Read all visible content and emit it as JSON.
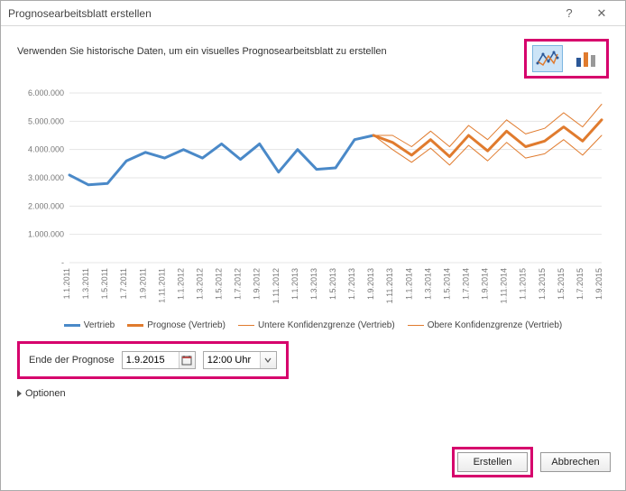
{
  "titlebar": {
    "title": "Prognosearbeitsblatt erstellen",
    "help": "?",
    "close": "✕"
  },
  "description": "Verwenden Sie historische Daten, um ein visuelles Prognosearbeitsblatt zu erstellen",
  "chart_type": {
    "line_selected": true
  },
  "chart_data": {
    "type": "line",
    "title": "",
    "xlabel": "",
    "ylabel": "",
    "ylim": [
      0,
      6000000
    ],
    "y_ticks": [
      "-",
      "1.000.000",
      "2.000.000",
      "3.000.000",
      "4.000.000",
      "5.000.000",
      "6.000.000"
    ],
    "categories": [
      "1.1.2011",
      "1.3.2011",
      "1.5.2011",
      "1.7.2011",
      "1.9.2011",
      "1.11.2011",
      "1.1.2012",
      "1.3.2012",
      "1.5.2012",
      "1.7.2012",
      "1.9.2012",
      "1.11.2012",
      "1.1.2013",
      "1.3.2013",
      "1.5.2013",
      "1.7.2013",
      "1.9.2013",
      "1.11.2013",
      "1.1.2014",
      "1.3.2014",
      "1.5.2014",
      "1.7.2014",
      "1.9.2014",
      "1.11.2014",
      "1.1.2015",
      "1.3.2015",
      "1.5.2015",
      "1.7.2015",
      "1.9.2015"
    ],
    "series": [
      {
        "name": "Vertrieb",
        "color": "#4a89c8",
        "width": 3,
        "values": [
          3100000,
          2750000,
          2800000,
          3600000,
          3900000,
          3700000,
          4000000,
          3700000,
          4200000,
          3650000,
          4200000,
          3200000,
          4000000,
          3300000,
          3350000,
          4350000,
          4500000,
          null,
          null,
          null,
          null,
          null,
          null,
          null,
          null,
          null,
          null,
          null,
          null
        ]
      },
      {
        "name": "Prognose (Vertrieb)",
        "color": "#e07b2e",
        "width": 3,
        "values": [
          null,
          null,
          null,
          null,
          null,
          null,
          null,
          null,
          null,
          null,
          null,
          null,
          null,
          null,
          null,
          null,
          4500000,
          4250000,
          3800000,
          4350000,
          3750000,
          4500000,
          3950000,
          4650000,
          4100000,
          4300000,
          4800000,
          4300000,
          5050000
        ]
      },
      {
        "name": "Untere Konfidenzgrenze (Vertrieb)",
        "color": "#e07b2e",
        "width": 1,
        "values": [
          null,
          null,
          null,
          null,
          null,
          null,
          null,
          null,
          null,
          null,
          null,
          null,
          null,
          null,
          null,
          null,
          4500000,
          4000000,
          3550000,
          4050000,
          3450000,
          4150000,
          3600000,
          4250000,
          3700000,
          3850000,
          4350000,
          3800000,
          4500000
        ]
      },
      {
        "name": "Obere Konfidenzgrenze (Vertrieb)",
        "color": "#e07b2e",
        "width": 1,
        "values": [
          null,
          null,
          null,
          null,
          null,
          null,
          null,
          null,
          null,
          null,
          null,
          null,
          null,
          null,
          null,
          null,
          4500000,
          4500000,
          4100000,
          4650000,
          4100000,
          4850000,
          4350000,
          5050000,
          4550000,
          4750000,
          5300000,
          4800000,
          5600000
        ]
      }
    ]
  },
  "legend": [
    {
      "label": "Vertrieb",
      "color": "#4a89c8",
      "w": 3
    },
    {
      "label": "Prognose (Vertrieb)",
      "color": "#e07b2e",
      "w": 3
    },
    {
      "label": "Untere Konfidenzgrenze (Vertrieb)",
      "color": "#e07b2e",
      "w": 1
    },
    {
      "label": "Obere Konfidenzgrenze (Vertrieb)",
      "color": "#e07b2e",
      "w": 1
    }
  ],
  "form": {
    "end_label": "Ende der Prognose",
    "end_date": "1.9.2015",
    "end_time": "12:00 Uhr"
  },
  "options": {
    "label": "Optionen"
  },
  "buttons": {
    "create": "Erstellen",
    "cancel": "Abbrechen"
  }
}
